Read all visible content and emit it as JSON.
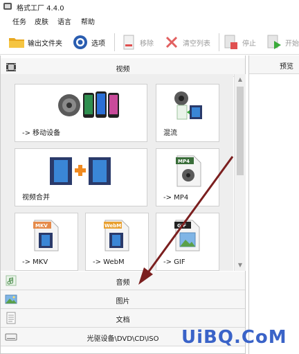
{
  "window": {
    "title": "格式工厂 4.4.0"
  },
  "menu": [
    "任务",
    "皮肤",
    "语言",
    "帮助"
  ],
  "toolbar": {
    "output_folder": "输出文件夹",
    "options": "选项",
    "remove": "移除",
    "clear_list": "清空列表",
    "stop": "停止",
    "start": "开始"
  },
  "categories": {
    "video": "视频",
    "audio": "音频",
    "image": "图片",
    "document": "文档",
    "rom": "光驱设备\\DVD\\CD\\ISO"
  },
  "tiles": {
    "mobile": "-> 移动设备",
    "mix": "混流",
    "join": "视频合并",
    "mp4": "-> MP4",
    "mkv": "-> MKV",
    "webm": "-> WebM",
    "gif": "-> GIF"
  },
  "preview": {
    "label": "预览"
  },
  "badges": {
    "mp4": "MP4",
    "mkv": "MKV",
    "webm": "WebM",
    "gif": "GIF"
  },
  "watermark": "UiBQ.CoM"
}
